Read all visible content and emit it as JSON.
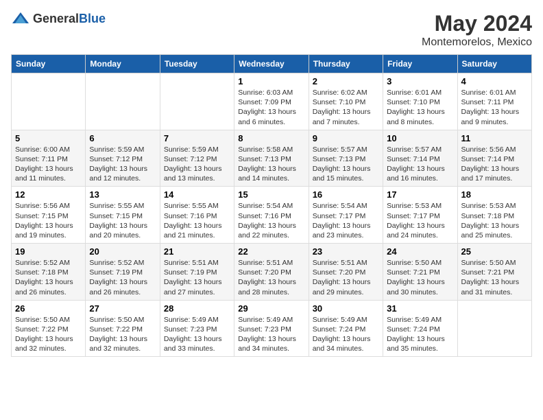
{
  "logo": {
    "general": "General",
    "blue": "Blue"
  },
  "title": "May 2024",
  "subtitle": "Montemorelos, Mexico",
  "weekdays": [
    "Sunday",
    "Monday",
    "Tuesday",
    "Wednesday",
    "Thursday",
    "Friday",
    "Saturday"
  ],
  "weeks": [
    [
      {
        "day": "",
        "sunrise": "",
        "sunset": "",
        "daylight": ""
      },
      {
        "day": "",
        "sunrise": "",
        "sunset": "",
        "daylight": ""
      },
      {
        "day": "",
        "sunrise": "",
        "sunset": "",
        "daylight": ""
      },
      {
        "day": "1",
        "sunrise": "Sunrise: 6:03 AM",
        "sunset": "Sunset: 7:09 PM",
        "daylight": "Daylight: 13 hours and 6 minutes."
      },
      {
        "day": "2",
        "sunrise": "Sunrise: 6:02 AM",
        "sunset": "Sunset: 7:10 PM",
        "daylight": "Daylight: 13 hours and 7 minutes."
      },
      {
        "day": "3",
        "sunrise": "Sunrise: 6:01 AM",
        "sunset": "Sunset: 7:10 PM",
        "daylight": "Daylight: 13 hours and 8 minutes."
      },
      {
        "day": "4",
        "sunrise": "Sunrise: 6:01 AM",
        "sunset": "Sunset: 7:11 PM",
        "daylight": "Daylight: 13 hours and 9 minutes."
      }
    ],
    [
      {
        "day": "5",
        "sunrise": "Sunrise: 6:00 AM",
        "sunset": "Sunset: 7:11 PM",
        "daylight": "Daylight: 13 hours and 11 minutes."
      },
      {
        "day": "6",
        "sunrise": "Sunrise: 5:59 AM",
        "sunset": "Sunset: 7:12 PM",
        "daylight": "Daylight: 13 hours and 12 minutes."
      },
      {
        "day": "7",
        "sunrise": "Sunrise: 5:59 AM",
        "sunset": "Sunset: 7:12 PM",
        "daylight": "Daylight: 13 hours and 13 minutes."
      },
      {
        "day": "8",
        "sunrise": "Sunrise: 5:58 AM",
        "sunset": "Sunset: 7:13 PM",
        "daylight": "Daylight: 13 hours and 14 minutes."
      },
      {
        "day": "9",
        "sunrise": "Sunrise: 5:57 AM",
        "sunset": "Sunset: 7:13 PM",
        "daylight": "Daylight: 13 hours and 15 minutes."
      },
      {
        "day": "10",
        "sunrise": "Sunrise: 5:57 AM",
        "sunset": "Sunset: 7:14 PM",
        "daylight": "Daylight: 13 hours and 16 minutes."
      },
      {
        "day": "11",
        "sunrise": "Sunrise: 5:56 AM",
        "sunset": "Sunset: 7:14 PM",
        "daylight": "Daylight: 13 hours and 17 minutes."
      }
    ],
    [
      {
        "day": "12",
        "sunrise": "Sunrise: 5:56 AM",
        "sunset": "Sunset: 7:15 PM",
        "daylight": "Daylight: 13 hours and 19 minutes."
      },
      {
        "day": "13",
        "sunrise": "Sunrise: 5:55 AM",
        "sunset": "Sunset: 7:15 PM",
        "daylight": "Daylight: 13 hours and 20 minutes."
      },
      {
        "day": "14",
        "sunrise": "Sunrise: 5:55 AM",
        "sunset": "Sunset: 7:16 PM",
        "daylight": "Daylight: 13 hours and 21 minutes."
      },
      {
        "day": "15",
        "sunrise": "Sunrise: 5:54 AM",
        "sunset": "Sunset: 7:16 PM",
        "daylight": "Daylight: 13 hours and 22 minutes."
      },
      {
        "day": "16",
        "sunrise": "Sunrise: 5:54 AM",
        "sunset": "Sunset: 7:17 PM",
        "daylight": "Daylight: 13 hours and 23 minutes."
      },
      {
        "day": "17",
        "sunrise": "Sunrise: 5:53 AM",
        "sunset": "Sunset: 7:17 PM",
        "daylight": "Daylight: 13 hours and 24 minutes."
      },
      {
        "day": "18",
        "sunrise": "Sunrise: 5:53 AM",
        "sunset": "Sunset: 7:18 PM",
        "daylight": "Daylight: 13 hours and 25 minutes."
      }
    ],
    [
      {
        "day": "19",
        "sunrise": "Sunrise: 5:52 AM",
        "sunset": "Sunset: 7:18 PM",
        "daylight": "Daylight: 13 hours and 26 minutes."
      },
      {
        "day": "20",
        "sunrise": "Sunrise: 5:52 AM",
        "sunset": "Sunset: 7:19 PM",
        "daylight": "Daylight: 13 hours and 26 minutes."
      },
      {
        "day": "21",
        "sunrise": "Sunrise: 5:51 AM",
        "sunset": "Sunset: 7:19 PM",
        "daylight": "Daylight: 13 hours and 27 minutes."
      },
      {
        "day": "22",
        "sunrise": "Sunrise: 5:51 AM",
        "sunset": "Sunset: 7:20 PM",
        "daylight": "Daylight: 13 hours and 28 minutes."
      },
      {
        "day": "23",
        "sunrise": "Sunrise: 5:51 AM",
        "sunset": "Sunset: 7:20 PM",
        "daylight": "Daylight: 13 hours and 29 minutes."
      },
      {
        "day": "24",
        "sunrise": "Sunrise: 5:50 AM",
        "sunset": "Sunset: 7:21 PM",
        "daylight": "Daylight: 13 hours and 30 minutes."
      },
      {
        "day": "25",
        "sunrise": "Sunrise: 5:50 AM",
        "sunset": "Sunset: 7:21 PM",
        "daylight": "Daylight: 13 hours and 31 minutes."
      }
    ],
    [
      {
        "day": "26",
        "sunrise": "Sunrise: 5:50 AM",
        "sunset": "Sunset: 7:22 PM",
        "daylight": "Daylight: 13 hours and 32 minutes."
      },
      {
        "day": "27",
        "sunrise": "Sunrise: 5:50 AM",
        "sunset": "Sunset: 7:22 PM",
        "daylight": "Daylight: 13 hours and 32 minutes."
      },
      {
        "day": "28",
        "sunrise": "Sunrise: 5:49 AM",
        "sunset": "Sunset: 7:23 PM",
        "daylight": "Daylight: 13 hours and 33 minutes."
      },
      {
        "day": "29",
        "sunrise": "Sunrise: 5:49 AM",
        "sunset": "Sunset: 7:23 PM",
        "daylight": "Daylight: 13 hours and 34 minutes."
      },
      {
        "day": "30",
        "sunrise": "Sunrise: 5:49 AM",
        "sunset": "Sunset: 7:24 PM",
        "daylight": "Daylight: 13 hours and 34 minutes."
      },
      {
        "day": "31",
        "sunrise": "Sunrise: 5:49 AM",
        "sunset": "Sunset: 7:24 PM",
        "daylight": "Daylight: 13 hours and 35 minutes."
      },
      {
        "day": "",
        "sunrise": "",
        "sunset": "",
        "daylight": ""
      }
    ]
  ]
}
